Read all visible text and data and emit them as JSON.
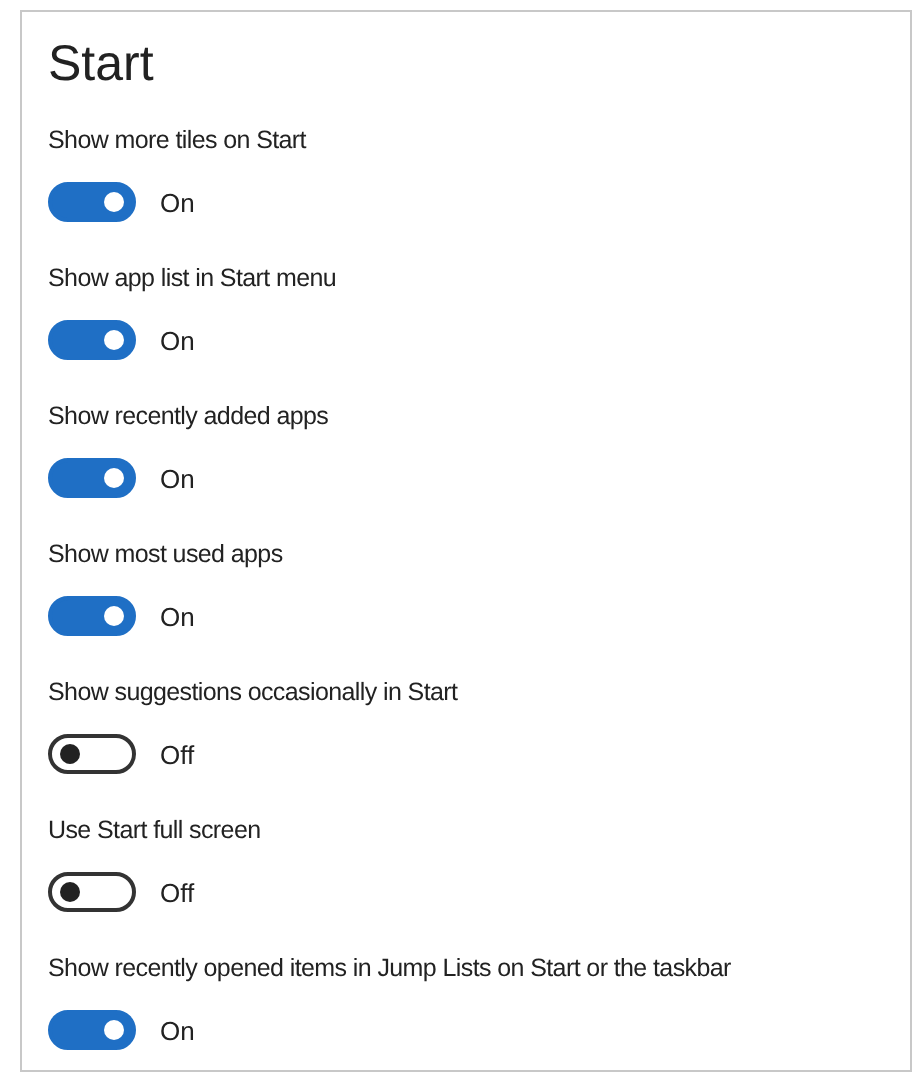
{
  "title": "Start",
  "settings": [
    {
      "label": "Show more tiles on Start",
      "on": true,
      "state": "On"
    },
    {
      "label": "Show app list in Start menu",
      "on": true,
      "state": "On"
    },
    {
      "label": "Show recently added apps",
      "on": true,
      "state": "On"
    },
    {
      "label": "Show most used apps",
      "on": true,
      "state": "On"
    },
    {
      "label": "Show suggestions occasionally in Start",
      "on": false,
      "state": "Off"
    },
    {
      "label": "Use Start full screen",
      "on": false,
      "state": "Off"
    },
    {
      "label": "Show recently opened items in Jump Lists on Start or the taskbar",
      "on": true,
      "state": "On"
    }
  ]
}
